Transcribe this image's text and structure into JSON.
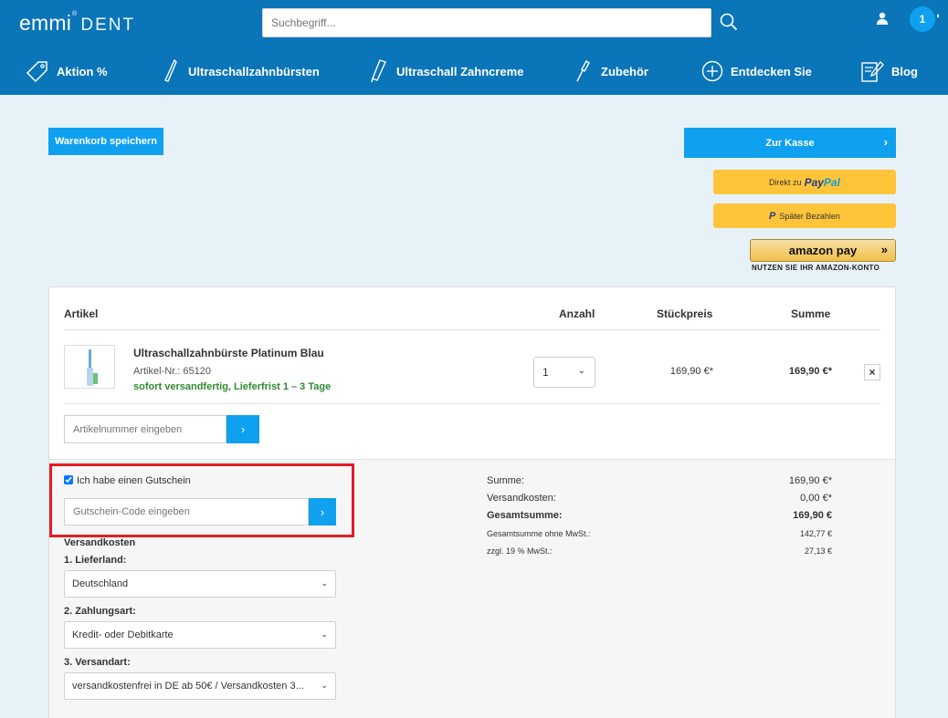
{
  "header": {
    "logo_main": "emmi",
    "logo_reg": "®",
    "logo_sub": "DENT",
    "search_placeholder": "Suchbegriff...",
    "cart_count": "1"
  },
  "nav": [
    {
      "label": "Aktion %",
      "icon": "tag-icon"
    },
    {
      "label": "Ultraschallzahnbürsten",
      "icon": "toothbrush-icon"
    },
    {
      "label": "Ultraschall Zahncreme",
      "icon": "toothpaste-icon"
    },
    {
      "label": "Zubehör",
      "icon": "brush-head-icon"
    },
    {
      "label": "Entdecken Sie",
      "icon": "plus-circle-icon"
    },
    {
      "label": "Blog",
      "icon": "edit-icon"
    }
  ],
  "actions": {
    "save_cart": "Warenkorb speichern",
    "checkout": "Zur Kasse",
    "paypal_prefix": "Direkt zu",
    "paypal_word_1": "Pay",
    "paypal_word_2": "Pal",
    "pay_later": "Später Bezahlen",
    "amazon_pay": "amazon pay",
    "amazon_note": "NUTZEN SIE IHR AMAZON-KONTO"
  },
  "table": {
    "headers": {
      "article": "Artikel",
      "qty": "Anzahl",
      "unit_price": "Stückpreis",
      "total": "Summe"
    },
    "item": {
      "title": "Ultraschallzahnbürste Platinum Blau",
      "number": "Artikel-Nr.: 65120",
      "shipping": "sofort versandfertig, Lieferfrist 1 – 3 Tage",
      "qty": "1",
      "unit_price": "169,90 €*",
      "total": "169,90 €*"
    },
    "artnum_placeholder": "Artikelnummer eingeben"
  },
  "voucher": {
    "checkbox_label": "Ich habe einen Gutschein",
    "checked": true,
    "placeholder": "Gutschein-Code eingeben"
  },
  "shipping": {
    "heading": "Versandkosten",
    "country_label": "1. Lieferland:",
    "country_value": "Deutschland",
    "payment_label": "2. Zahlungsart:",
    "payment_value": "Kredit- oder Debitkarte",
    "method_label": "3. Versandart:",
    "method_value": "versandkostenfrei in DE ab 50€ / Versandkosten 3..."
  },
  "summary": [
    {
      "label": "Summe:",
      "value": "169,90 €*"
    },
    {
      "label": "Versandkosten:",
      "value": "0,00 €*"
    },
    {
      "label": "Gesamtsumme:",
      "value": "169,90 €"
    },
    {
      "label": "Gesamtsumme ohne MwSt.:",
      "value": "142,77 €"
    },
    {
      "label": "zzgl. 19 % MwSt.:",
      "value": "27,13 €"
    }
  ],
  "colors": {
    "header": "#0a75b8",
    "accent": "#0fa0ef",
    "paypal_yellow": "#ffc439",
    "highlight": "#e11d25",
    "ship_green": "#2f8a2f"
  }
}
